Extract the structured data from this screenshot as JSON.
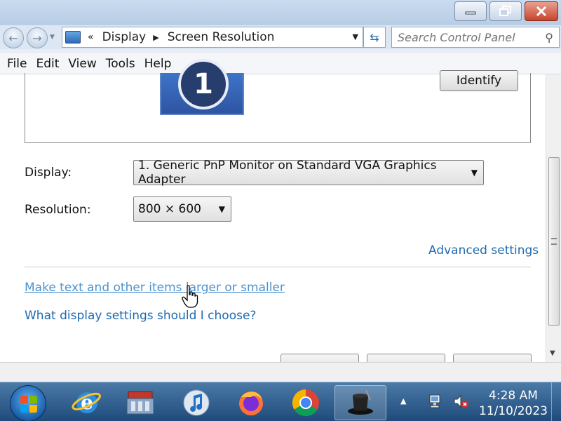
{
  "window": {
    "title_bar_buttons": [
      "minimize",
      "restore",
      "close"
    ]
  },
  "address_bar": {
    "overflow_chevron": "«",
    "breadcrumb": [
      "Display",
      "Screen Resolution"
    ],
    "search_placeholder": "Search Control Panel"
  },
  "menu": {
    "items": [
      "File",
      "Edit",
      "View",
      "Tools",
      "Help"
    ]
  },
  "monitor_preview": {
    "number": "1",
    "identify_label": "Identify"
  },
  "settings": {
    "display_label": "Display:",
    "display_value": "1. Generic PnP Monitor on Standard VGA Graphics Adapter",
    "resolution_label": "Resolution:",
    "resolution_value": "800 × 600",
    "advanced_link": "Advanced settings",
    "text_size_link": "Make text and other items larger or smaller",
    "help_link": "What display settings should I choose?"
  },
  "taskbar": {
    "apps": [
      "internet-explorer",
      "control-panel",
      "itunes",
      "firefox",
      "chrome",
      "active-app"
    ],
    "time": "4:28 AM",
    "date": "11/10/2023"
  },
  "colors": {
    "link": "#1e6ab1",
    "taskbar": "#1e4b7b",
    "titlebar": "#c9dbee"
  }
}
